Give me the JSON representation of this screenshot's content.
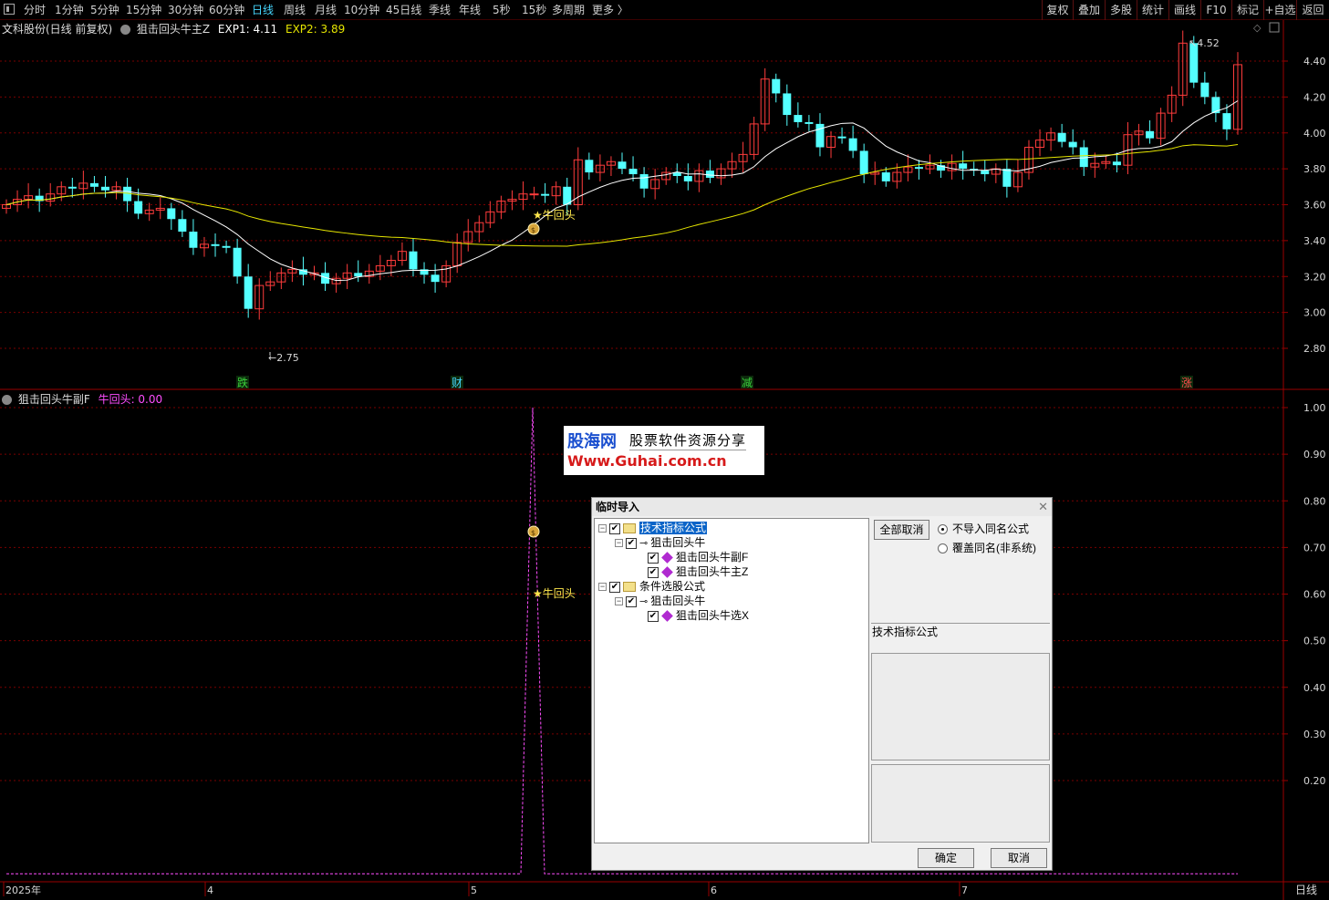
{
  "toolbar": {
    "periods": [
      {
        "label": "分时",
        "active": false
      },
      {
        "label": "1分钟",
        "active": false
      },
      {
        "label": "5分钟",
        "active": false
      },
      {
        "label": "15分钟",
        "active": false
      },
      {
        "label": "30分钟",
        "active": false
      },
      {
        "label": "60分钟",
        "active": false
      },
      {
        "label": "日线",
        "active": true
      },
      {
        "label": "周线",
        "active": false
      },
      {
        "label": "月线",
        "active": false
      },
      {
        "label": "10分钟",
        "active": false
      },
      {
        "label": "45日线",
        "active": false
      },
      {
        "label": "季线",
        "active": false
      },
      {
        "label": "年线",
        "active": false
      },
      {
        "label": "5秒",
        "active": false
      },
      {
        "label": "15秒",
        "active": false
      },
      {
        "label": "多周期",
        "active": false
      },
      {
        "label": "更多 〉",
        "active": false
      }
    ],
    "right_buttons": [
      "复权",
      "叠加",
      "多股",
      "统计",
      "画线",
      "F10",
      "标记",
      "+自选",
      "返回"
    ]
  },
  "main_panel": {
    "stock_label": "文科股份(日线 前复权)",
    "indicator_name": "狙击回头牛主Z",
    "exp1_label": "EXP1: 4.11",
    "exp2_label": "EXP2: 3.89",
    "price_ticks": [
      "4.40",
      "4.20",
      "4.00",
      "3.80",
      "3.60",
      "3.40",
      "3.20",
      "3.00",
      "2.80"
    ],
    "low_marker": "2.75",
    "high_marker": "4.52",
    "signal_label": "★牛回头",
    "event_marks": [
      {
        "text": "跌",
        "color": "#3bd23b"
      },
      {
        "text": "财",
        "color": "#46d7ff"
      },
      {
        "text": "减",
        "color": "#3bd23b"
      },
      {
        "text": "涨",
        "color": "#ff4d4d"
      }
    ]
  },
  "sub_panel": {
    "indicator_name": "狙击回头牛副F",
    "value_label": "牛回头: 0.00",
    "value_ticks": [
      "1.00",
      "0.90",
      "0.80",
      "0.70",
      "0.60",
      "0.50",
      "0.40",
      "0.30",
      "0.20"
    ],
    "signal_label": "★牛回头"
  },
  "time_axis": {
    "labels": [
      "2025年",
      "4",
      "5",
      "6",
      "7"
    ],
    "period_label": "日线"
  },
  "watermark": {
    "brand": "股海网",
    "slogan": "股票软件资源分享",
    "url": "Www.Guhai.com.cn"
  },
  "dialog": {
    "title": "临时导入",
    "close_symbol": "✕",
    "tree": [
      {
        "label": "技术指标公式",
        "level": 0,
        "kind": "folder",
        "selected": true
      },
      {
        "label": "狙击回头牛",
        "level": 1,
        "kind": "key",
        "selected": false
      },
      {
        "label": "狙击回头牛副F",
        "level": 2,
        "kind": "item",
        "selected": false
      },
      {
        "label": "狙击回头牛主Z",
        "level": 2,
        "kind": "item",
        "selected": false
      },
      {
        "label": "条件选股公式",
        "level": 0,
        "kind": "folder",
        "selected": false
      },
      {
        "label": "狙击回头牛",
        "level": 1,
        "kind": "key",
        "selected": false
      },
      {
        "label": "狙击回头牛选X",
        "level": 2,
        "kind": "item",
        "selected": false
      }
    ],
    "cancel_all_label": "全部取消",
    "radio_options": [
      {
        "label": "不导入同名公式",
        "checked": true
      },
      {
        "label": "覆盖同名(非系统)",
        "checked": false
      }
    ],
    "type_label": "技术指标公式",
    "ok_label": "确定",
    "cancel_label": "取消"
  },
  "colors": {
    "up": "#ff3c3c",
    "down": "#54ffff",
    "ma_short": "#ffffff",
    "ma_long": "#e6e600",
    "grid": "#7a0000",
    "signal_line": "#ff4dff",
    "axis_text": "#d8d8d8"
  }
}
